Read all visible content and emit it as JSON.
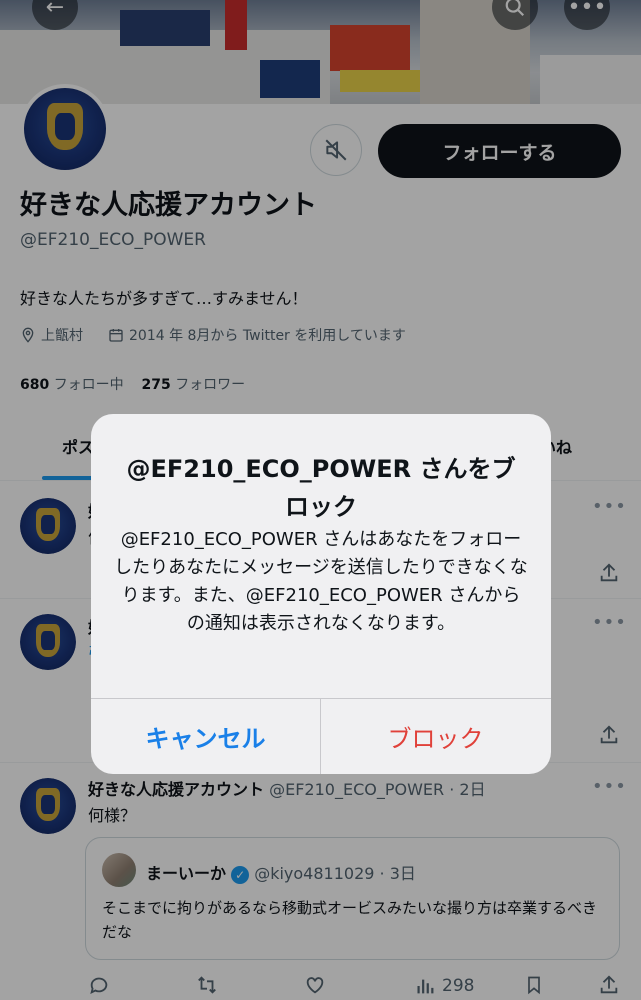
{
  "profile": {
    "display_name": "好きな人応援アカウント",
    "handle": "@EF210_ECO_POWER",
    "bio": "好きな人たちが多すぎて…すみません！",
    "location": "上甑村",
    "joined": "2014 年 8月から Twitter を利用しています",
    "following_count": "680",
    "following_label": "フォロー中",
    "followers_count": "275",
    "followers_label": "フォロワー",
    "follow_button": "フォローする"
  },
  "tabs": [
    {
      "label": "ポス"
    },
    {
      "label": "いね"
    }
  ],
  "tweets": [
    {
      "name_partial": "好",
      "text_partial": "何"
    },
    {
      "name_partial": "好",
      "text_partial": "引"
    }
  ],
  "tweet3": {
    "name": "好きな人応援アカウント",
    "handle_time": "@EF210_ECO_POWER · 2日",
    "text": "何様？",
    "quote": {
      "name": "まーいーか",
      "handle_time": "@kiyo4811029 · 3日",
      "text": "そこまでに拘りがあるなら移動式オービスみたいな撮り方は卒業するべきだな"
    },
    "views": "298"
  },
  "dialog": {
    "title": "@EF210_ECO_POWER さんをブロック",
    "message": "@EF210_ECO_POWER さんはあなたをフォローしたりあなたにメッセージを送信したりできなくなります。また、@EF210_ECO_POWER さんからの通知は表示されなくなります。",
    "cancel_label": "キャンセル",
    "block_label": "ブロック"
  },
  "colors": {
    "accent": "#1d9bf0",
    "cancel": "#1a80e8",
    "block": "#e0413a",
    "dark_button": "#0f1419"
  }
}
